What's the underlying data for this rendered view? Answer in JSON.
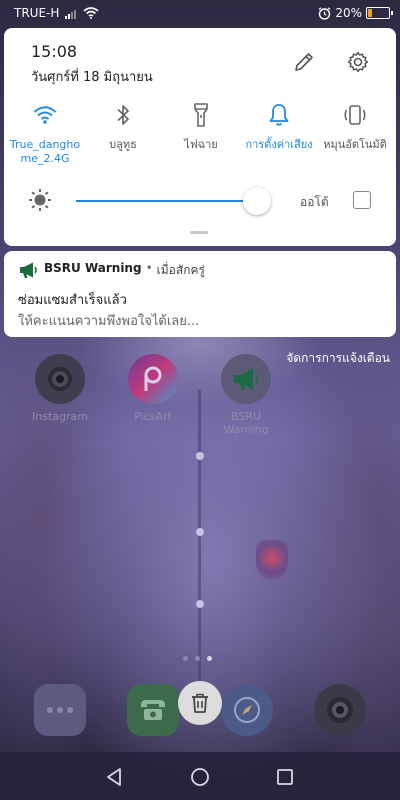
{
  "status_bar": {
    "carrier": "TRUE-H",
    "battery_text": "20%",
    "battery_level": 0.2,
    "icons": [
      "signal-icon",
      "wifi-icon",
      "alarm-icon",
      "battery-icon"
    ]
  },
  "quick_settings": {
    "time": "15:08",
    "date": "วันศุกร์ที่ 18 มิถุนายน",
    "edit_icon": "pencil-icon",
    "settings_icon": "gear-icon",
    "accent_color": "#1e88e5",
    "tiles": [
      {
        "label": "True_danghome_2.4G",
        "icon": "wifi-icon",
        "on": true
      },
      {
        "label": "บลูทูธ",
        "icon": "bluetooth-icon",
        "on": false
      },
      {
        "label": "ไฟฉาย",
        "icon": "flashlight-icon",
        "on": false
      },
      {
        "label": "การตั้งค่าเสียง",
        "icon": "bell-icon",
        "on": true
      },
      {
        "label": "หมุนอัตโนมัติ",
        "icon": "rotate-icon",
        "on": false
      }
    ],
    "brightness": {
      "level": 0.88,
      "auto_label": "ออโต้",
      "auto_checked": false
    }
  },
  "notification": {
    "app_name": "BSRU Warning",
    "separator": "•",
    "time": "เมื่อสักครู่",
    "title": "ซ่อมแซมสำเร็จแล้ว",
    "text": "ให้คะแนนความพึงพอใจได้เลย..."
  },
  "manage_notifications": "จัดการการแจ้งเตือน",
  "home": {
    "apps": [
      {
        "label": "Instagram",
        "icon": "camera-lens-icon"
      },
      {
        "label": "PicsArt",
        "icon": "picsart-icon"
      },
      {
        "label": "BSRU Warning",
        "icon": "megaphone-icon"
      }
    ],
    "page_count": 3,
    "active_page": 3,
    "dock": [
      "more-apps-icon",
      "phone-icon",
      "compass-icon",
      "camera-icon"
    ],
    "trash_icon": "trash-icon"
  },
  "nav": [
    "back-icon",
    "home-icon",
    "recents-icon"
  ]
}
